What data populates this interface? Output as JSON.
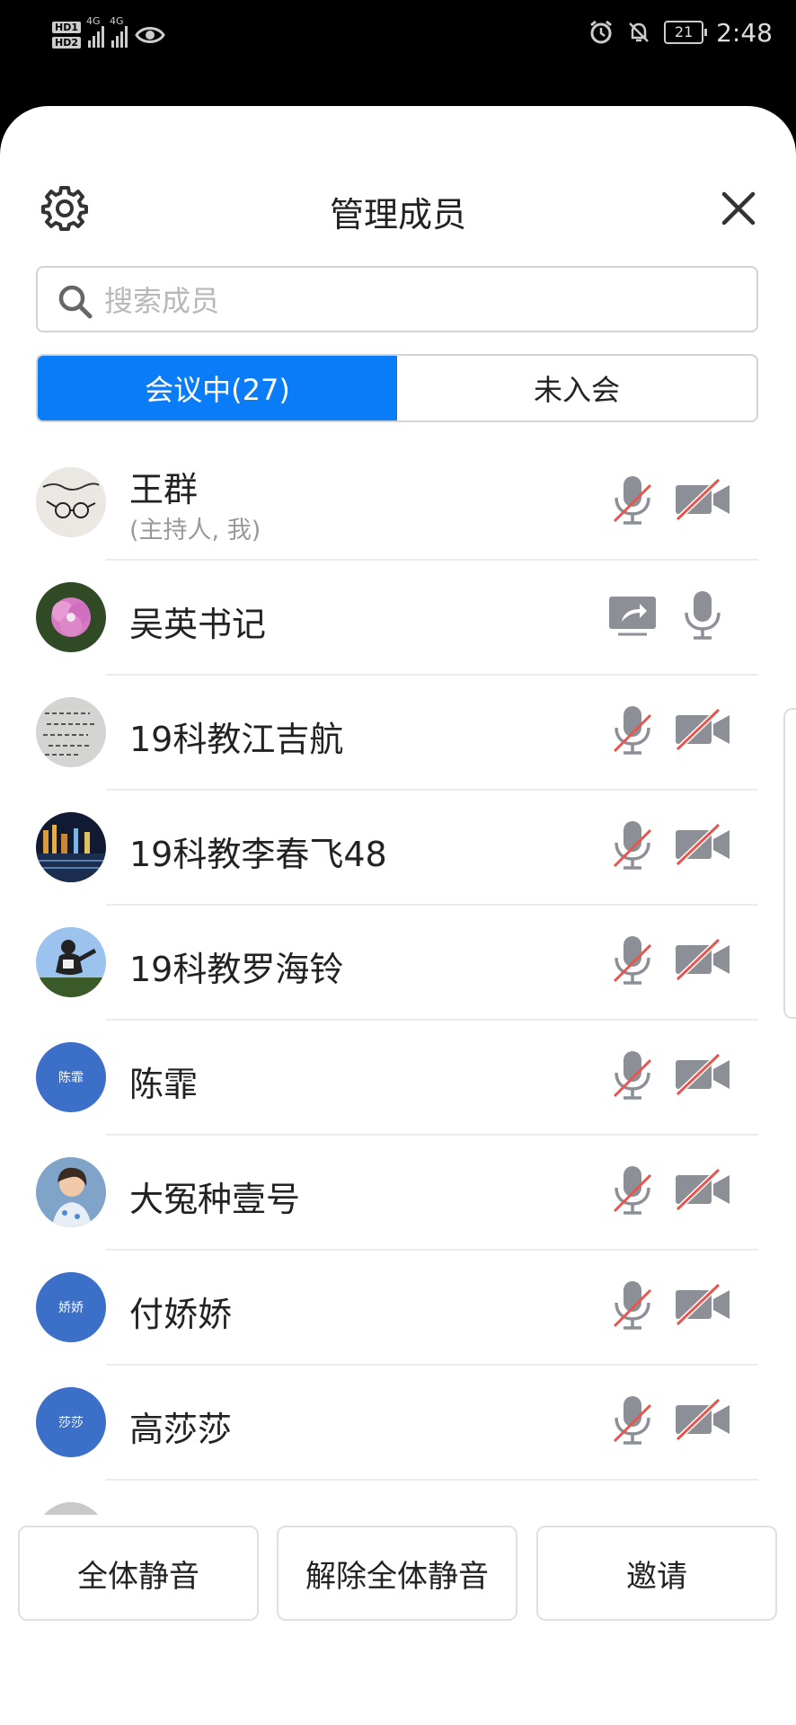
{
  "status_bar": {
    "hd1": "HD1",
    "hd2": "HD2",
    "signal1": "4G",
    "signal2": "4G",
    "battery": "21",
    "time": "2:48"
  },
  "header": {
    "title": "管理成员",
    "settings_icon": "gear-icon",
    "close_icon": "close-icon"
  },
  "search": {
    "placeholder": "搜索成员",
    "value": ""
  },
  "tabs": [
    {
      "label": "会议中(27)",
      "active": true
    },
    {
      "label": "未入会",
      "active": false
    }
  ],
  "members": [
    {
      "name": "王群",
      "role": "(主持人, 我)",
      "avatar": "photo-handwriting-glasses",
      "icons": [
        "mic-muted",
        "camera-off"
      ]
    },
    {
      "name": "吴英书记",
      "role": "",
      "avatar": "photo-pink-flower",
      "icons": [
        "screen-share",
        "mic-on"
      ]
    },
    {
      "name": "19科教江吉航",
      "role": "",
      "avatar": "photo-handwriting",
      "icons": [
        "mic-muted",
        "camera-off"
      ]
    },
    {
      "name": "19科教李春飞48",
      "role": "",
      "avatar": "photo-night-city",
      "icons": [
        "mic-muted",
        "camera-off"
      ]
    },
    {
      "name": "19科教罗海铃",
      "role": "",
      "avatar": "photo-cartoon-figure",
      "icons": [
        "mic-muted",
        "camera-off"
      ]
    },
    {
      "name": "陈霏",
      "role": "",
      "avatar_text": "陈霏",
      "icons": [
        "mic-muted",
        "camera-off"
      ]
    },
    {
      "name": "大冤种壹号",
      "role": "",
      "avatar": "photo-person",
      "icons": [
        "mic-muted",
        "camera-off"
      ]
    },
    {
      "name": "付娇娇",
      "role": "",
      "avatar_text": "娇娇",
      "icons": [
        "mic-muted",
        "camera-off"
      ]
    },
    {
      "name": "高莎莎",
      "role": "",
      "avatar_text": "莎莎",
      "icons": [
        "mic-muted",
        "camera-off"
      ]
    }
  ],
  "footer": {
    "mute_all": "全体静音",
    "unmute_all": "解除全体静音",
    "invite": "邀请"
  },
  "colors": {
    "accent": "#0a7cf8",
    "avatar_blue": "#3c6fc8",
    "muted_slash": "#e8554e",
    "icon_gray": "#8c8f96"
  }
}
